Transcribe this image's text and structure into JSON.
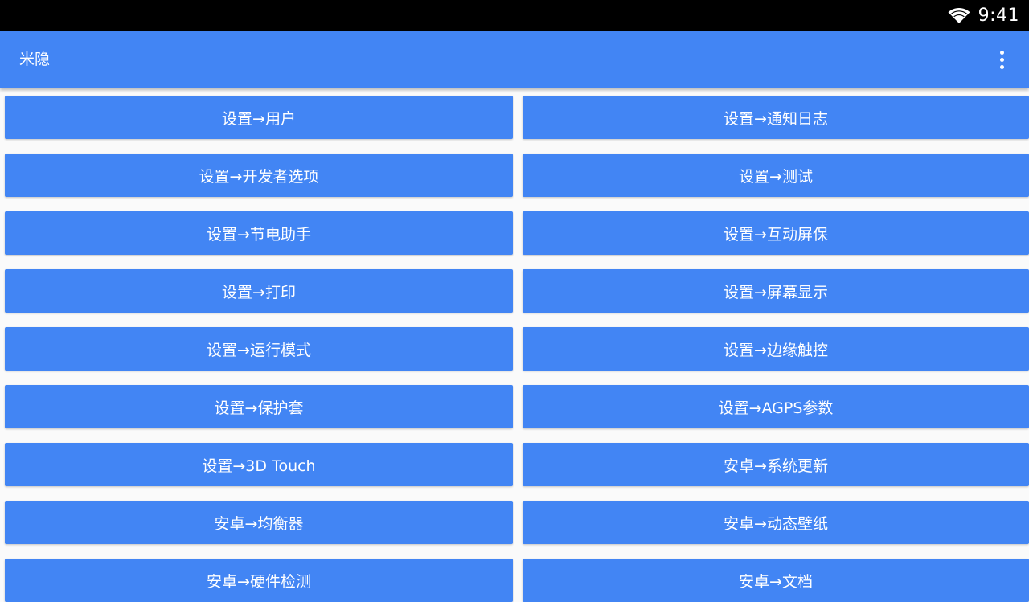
{
  "status_bar": {
    "time": "9:41",
    "icons": [
      "wifi-icon"
    ]
  },
  "app_bar": {
    "title": "米隐",
    "menu_icon": "overflow-menu-icon"
  },
  "colors": {
    "primary": "#4285f4",
    "status_bar": "#000000",
    "background": "#fafafa",
    "text_on_primary": "#ffffff"
  },
  "buttons": [
    "设置→用户",
    "设置→通知日志",
    "设置→开发者选项",
    "设置→测试",
    "设置→节电助手",
    "设置→互动屏保",
    "设置→打印",
    "设置→屏幕显示",
    "设置→运行模式",
    "设置→边缘触控",
    "设置→保护套",
    "设置→AGPS参数",
    "设置→3D Touch",
    "安卓→系统更新",
    "安卓→均衡器",
    "安卓→动态壁纸",
    "安卓→硬件检测",
    "安卓→文档"
  ]
}
